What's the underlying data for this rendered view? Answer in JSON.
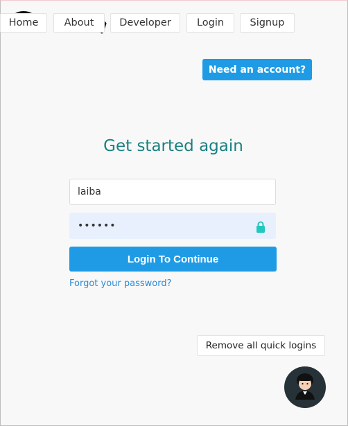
{
  "nav": {
    "items": [
      {
        "label": "Home"
      },
      {
        "label": "About"
      },
      {
        "label": "Developer"
      },
      {
        "label": "Login"
      },
      {
        "label": "Signup"
      }
    ]
  },
  "header": {
    "need_account_label": "Need an account?"
  },
  "form": {
    "title": "Get started again",
    "username_value": "laiba",
    "password_value": "••••••",
    "submit_label": "Login To Continue",
    "forgot_label": "Forgot your password?"
  },
  "footer": {
    "remove_quick_logins_label": "Remove all quick logins"
  },
  "colors": {
    "accent": "#1f9be6",
    "title": "#1a8080",
    "lock": "#1fc8c0"
  },
  "icons": {
    "lock": "lock-icon",
    "avatar": "avatar"
  }
}
